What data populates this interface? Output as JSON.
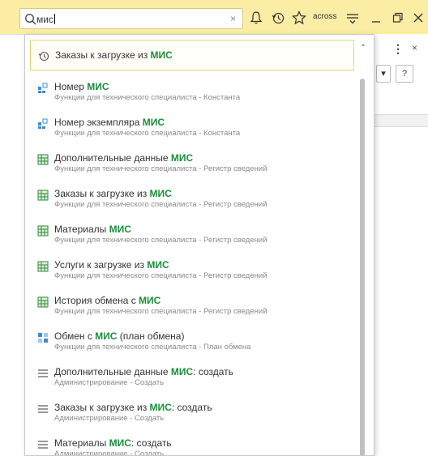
{
  "colors": {
    "toolbar": "#fbeda3",
    "highlight": "#1a8f3a",
    "subtitle": "#8a8a8a"
  },
  "search": {
    "value": "мис",
    "clear_icon": "close-icon"
  },
  "toolbar": {
    "icons": [
      "bell-icon",
      "history-icon",
      "star-icon",
      "menu-icon",
      "minimize-icon",
      "maximize-icon",
      "close-icon"
    ],
    "user": "across"
  },
  "background_window": {
    "more_label": "⋮",
    "close_label": "×",
    "dropdown_label": "▾",
    "help_label": "?"
  },
  "results": [
    {
      "icon": "history-icon",
      "before": "Заказы к загрузке из ",
      "match": "МИС",
      "after": "",
      "subtitle": "",
      "selected": true
    },
    {
      "icon": "constant-icon",
      "before": "Номер ",
      "match": "МИС",
      "after": "",
      "subtitle": "Функции для технического специалиста - Константа"
    },
    {
      "icon": "constant-icon",
      "before": "Номер экземпляра ",
      "match": "МИС",
      "after": "",
      "subtitle": "Функции для технического специалиста - Константа"
    },
    {
      "icon": "register-icon",
      "before": "Дополнительные данные ",
      "match": "МИС",
      "after": "",
      "subtitle": "Функции для технического специалиста - Регистр сведений"
    },
    {
      "icon": "register-icon",
      "before": "Заказы к загрузке из ",
      "match": "МИС",
      "after": "",
      "subtitle": "Функции для технического специалиста - Регистр сведений"
    },
    {
      "icon": "register-icon",
      "before": "Материалы ",
      "match": "МИС",
      "after": "",
      "subtitle": "Функции для технического специалиста - Регистр сведений"
    },
    {
      "icon": "register-icon",
      "before": "Услуги к загрузке из ",
      "match": "МИС",
      "after": "",
      "subtitle": "Функции для технического специалиста - Регистр сведений"
    },
    {
      "icon": "register-icon",
      "before": "История обмена с ",
      "match": "МИС",
      "after": "",
      "subtitle": "Функции для технического специалиста - Регистр сведений"
    },
    {
      "icon": "exchange-plan-icon",
      "before": "Обмен с ",
      "match": "МИС",
      "after": " (план обмена)",
      "subtitle": "Функции для технического специалиста - План обмена"
    },
    {
      "icon": "list-icon",
      "before": "Дополнительные данные ",
      "match": "МИС",
      "after": ": создать",
      "subtitle": "Администрирование - Создать"
    },
    {
      "icon": "list-icon",
      "before": "Заказы к загрузке из ",
      "match": "МИС",
      "after": ": создать",
      "subtitle": "Администрирование - Создать"
    },
    {
      "icon": "list-icon",
      "before": "Материалы ",
      "match": "МИС",
      "after": ": создать",
      "subtitle": "Администрирование - Создать"
    }
  ]
}
